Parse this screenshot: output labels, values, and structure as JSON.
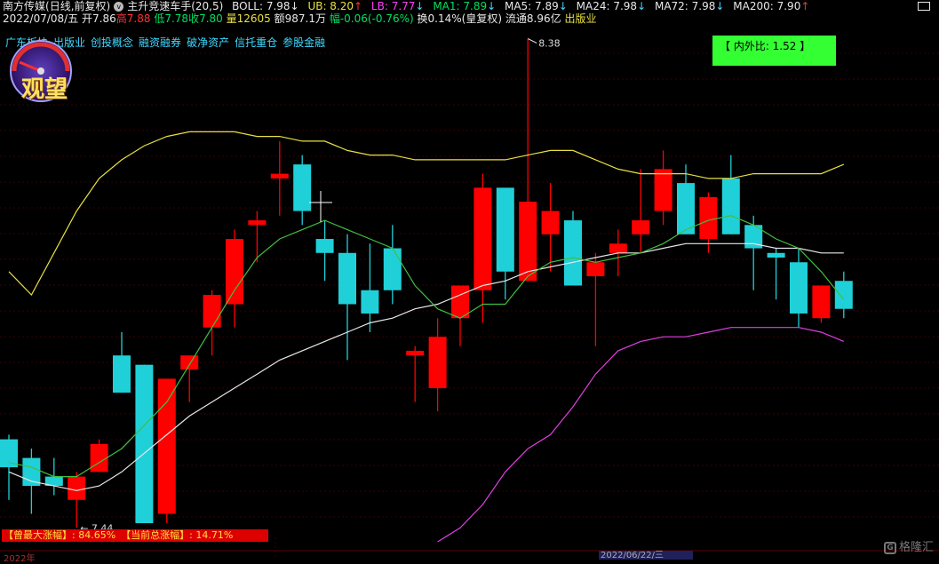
{
  "header": {
    "name": "南方传媒",
    "period": "(日线,前复权)",
    "indicator": "主升竞速车手(20,5)",
    "boll": "BOLL: 7.98",
    "boll_arrow": "↓",
    "ub": "UB: 8.20",
    "ub_arrow": "↑",
    "lb": "LB: 7.77",
    "lb_arrow": "↓",
    "ma1": "MA1: 7.89",
    "ma1_arrow": "↓",
    "ma5": "MA5: 7.89",
    "ma5_arrow": "↓",
    "ma24": "MA24: 7.98",
    "ma24_arrow": "↓",
    "ma72": "MA72: 7.98",
    "ma72_arrow": "↓",
    "ma200": "MA200: 7.90",
    "ma200_arrow": "↑"
  },
  "quote": {
    "date": "2022/07/08/五",
    "open": "开7.86",
    "high": "高7.88",
    "low": "低7.78",
    "close": "收7.80",
    "volume": "量12605",
    "amount": "额987.1万",
    "change": "幅-0.06(-0.76%)",
    "turnover": "换0.14%(皇复权)",
    "float": "流通8.96亿",
    "sector": "出版业"
  },
  "concepts": [
    "广东板块",
    "出版业",
    "创投概念",
    "融资融券",
    "破净资产",
    "信托重仓",
    "参股金融"
  ],
  "ratio_box": "【 内外比: 1.52 】",
  "logo_text": "观望",
  "stats": {
    "max_gain": "【曾最大涨幅】: 84.65%",
    "current_gain": "【当前总涨幅】: 14.71%"
  },
  "annotations": {
    "high_label": "8.38",
    "low_label": "7.44"
  },
  "bottom_left_date": "2022年",
  "bottom_date": "2022/06/22/三",
  "watermark": "格隆汇",
  "colors": {
    "up": "#ff0000",
    "down": "#20d0d8",
    "ub": "#e8e040",
    "lb": "#e040e0",
    "ma_green": "#40c040",
    "ma_white": "#e8e8e8"
  },
  "chart_data": {
    "type": "candlestick",
    "candles": [
      {
        "open": 7.52,
        "high": 7.53,
        "low": 7.39,
        "close": 7.46
      },
      {
        "open": 7.48,
        "high": 7.5,
        "low": 7.36,
        "close": 7.42
      },
      {
        "open": 7.44,
        "high": 7.48,
        "low": 7.4,
        "close": 7.42
      },
      {
        "open": 7.39,
        "high": 7.45,
        "low": 7.33,
        "close": 7.44
      },
      {
        "open": 7.45,
        "high": 7.52,
        "low": 7.45,
        "close": 7.51
      },
      {
        "open": 7.7,
        "high": 7.75,
        "low": 7.62,
        "close": 7.62
      },
      {
        "open": 7.68,
        "high": 7.68,
        "low": 7.34,
        "close": 7.34
      },
      {
        "open": 7.36,
        "high": 7.65,
        "low": 7.34,
        "close": 7.65
      },
      {
        "open": 7.67,
        "high": 7.7,
        "low": 7.6,
        "close": 7.7
      },
      {
        "open": 7.76,
        "high": 7.84,
        "low": 7.7,
        "close": 7.83
      },
      {
        "open": 7.81,
        "high": 7.97,
        "low": 7.76,
        "close": 7.95
      },
      {
        "open": 7.98,
        "high": 8.01,
        "low": 7.9,
        "close": 7.99
      },
      {
        "open": 8.08,
        "high": 8.16,
        "low": 8.0,
        "close": 8.09
      },
      {
        "open": 8.11,
        "high": 8.13,
        "low": 7.98,
        "close": 8.01
      },
      {
        "open": 7.95,
        "high": 7.99,
        "low": 7.86,
        "close": 7.92
      },
      {
        "open": 7.92,
        "high": 7.96,
        "low": 7.69,
        "close": 7.81
      },
      {
        "open": 7.84,
        "high": 7.94,
        "low": 7.75,
        "close": 7.79
      },
      {
        "open": 7.93,
        "high": 7.98,
        "low": 7.81,
        "close": 7.84
      },
      {
        "open": 7.7,
        "high": 7.72,
        "low": 7.6,
        "close": 7.71
      },
      {
        "open": 7.63,
        "high": 7.78,
        "low": 7.58,
        "close": 7.74
      },
      {
        "open": 7.78,
        "high": 7.85,
        "low": 7.72,
        "close": 7.85
      },
      {
        "open": 7.84,
        "high": 8.09,
        "low": 7.77,
        "close": 8.06
      },
      {
        "open": 8.06,
        "high": 8.01,
        "low": 7.82,
        "close": 7.88
      },
      {
        "open": 7.86,
        "high": 8.38,
        "low": 7.86,
        "close": 8.03
      },
      {
        "open": 7.96,
        "high": 8.07,
        "low": 7.88,
        "close": 8.01
      },
      {
        "open": 7.99,
        "high": 8.01,
        "low": 7.86,
        "close": 7.85
      },
      {
        "open": 7.87,
        "high": 7.92,
        "low": 7.72,
        "close": 7.9
      },
      {
        "open": 7.92,
        "high": 7.97,
        "low": 7.87,
        "close": 7.94
      },
      {
        "open": 7.96,
        "high": 8.1,
        "low": 7.92,
        "close": 7.99
      },
      {
        "open": 8.01,
        "high": 8.14,
        "low": 7.98,
        "close": 8.1
      },
      {
        "open": 8.07,
        "high": 8.11,
        "low": 7.97,
        "close": 7.96
      },
      {
        "open": 7.95,
        "high": 8.05,
        "low": 7.92,
        "close": 8.04
      },
      {
        "open": 8.08,
        "high": 8.13,
        "low": 7.96,
        "close": 7.96
      },
      {
        "open": 7.98,
        "high": 8.0,
        "low": 7.84,
        "close": 7.93
      },
      {
        "open": 7.92,
        "high": 7.93,
        "low": 7.82,
        "close": 7.91
      },
      {
        "open": 7.9,
        "high": 7.93,
        "low": 7.76,
        "close": 7.79
      },
      {
        "open": 7.78,
        "high": 7.83,
        "low": 7.77,
        "close": 7.85
      },
      {
        "open": 7.86,
        "high": 7.88,
        "low": 7.78,
        "close": 7.8
      }
    ],
    "ub": [
      7.88,
      7.83,
      7.92,
      8.01,
      8.08,
      8.12,
      8.15,
      8.17,
      8.18,
      8.18,
      8.18,
      8.17,
      8.17,
      8.16,
      8.16,
      8.14,
      8.13,
      8.13,
      8.12,
      8.12,
      8.12,
      8.12,
      8.12,
      8.13,
      8.14,
      8.14,
      8.12,
      8.1,
      8.09,
      8.09,
      8.09,
      8.08,
      8.08,
      8.09,
      8.09,
      8.09,
      8.09,
      8.11
    ],
    "boll": [
      7.45,
      7.43,
      7.42,
      7.41,
      7.42,
      7.45,
      7.49,
      7.53,
      7.57,
      7.6,
      7.63,
      7.66,
      7.69,
      7.71,
      7.73,
      7.75,
      7.77,
      7.78,
      7.8,
      7.81,
      7.83,
      7.85,
      7.86,
      7.88,
      7.89,
      7.9,
      7.91,
      7.92,
      7.92,
      7.93,
      7.94,
      7.94,
      7.94,
      7.94,
      7.93,
      7.93,
      7.92,
      7.92
    ],
    "lb": [
      7.3,
      7.3,
      7.3,
      7.3,
      7.3,
      7.3,
      7.3,
      7.3,
      7.3,
      7.3,
      7.3,
      7.3,
      7.3,
      7.3,
      7.3,
      7.3,
      7.3,
      7.3,
      7.3,
      7.3,
      7.33,
      7.38,
      7.45,
      7.5,
      7.53,
      7.59,
      7.66,
      7.71,
      7.73,
      7.74,
      7.74,
      7.75,
      7.76,
      7.76,
      7.76,
      7.76,
      7.75,
      7.73
    ],
    "ma": [
      7.47,
      7.46,
      7.44,
      7.44,
      7.47,
      7.5,
      7.55,
      7.6,
      7.68,
      7.76,
      7.84,
      7.91,
      7.95,
      7.97,
      7.99,
      7.97,
      7.95,
      7.93,
      7.85,
      7.8,
      7.78,
      7.81,
      7.81,
      7.87,
      7.9,
      7.91,
      7.9,
      7.91,
      7.92,
      7.94,
      7.97,
      7.99,
      8.0,
      7.98,
      7.95,
      7.93,
      7.88,
      7.82
    ],
    "ylim": [
      7.3,
      8.4
    ]
  }
}
